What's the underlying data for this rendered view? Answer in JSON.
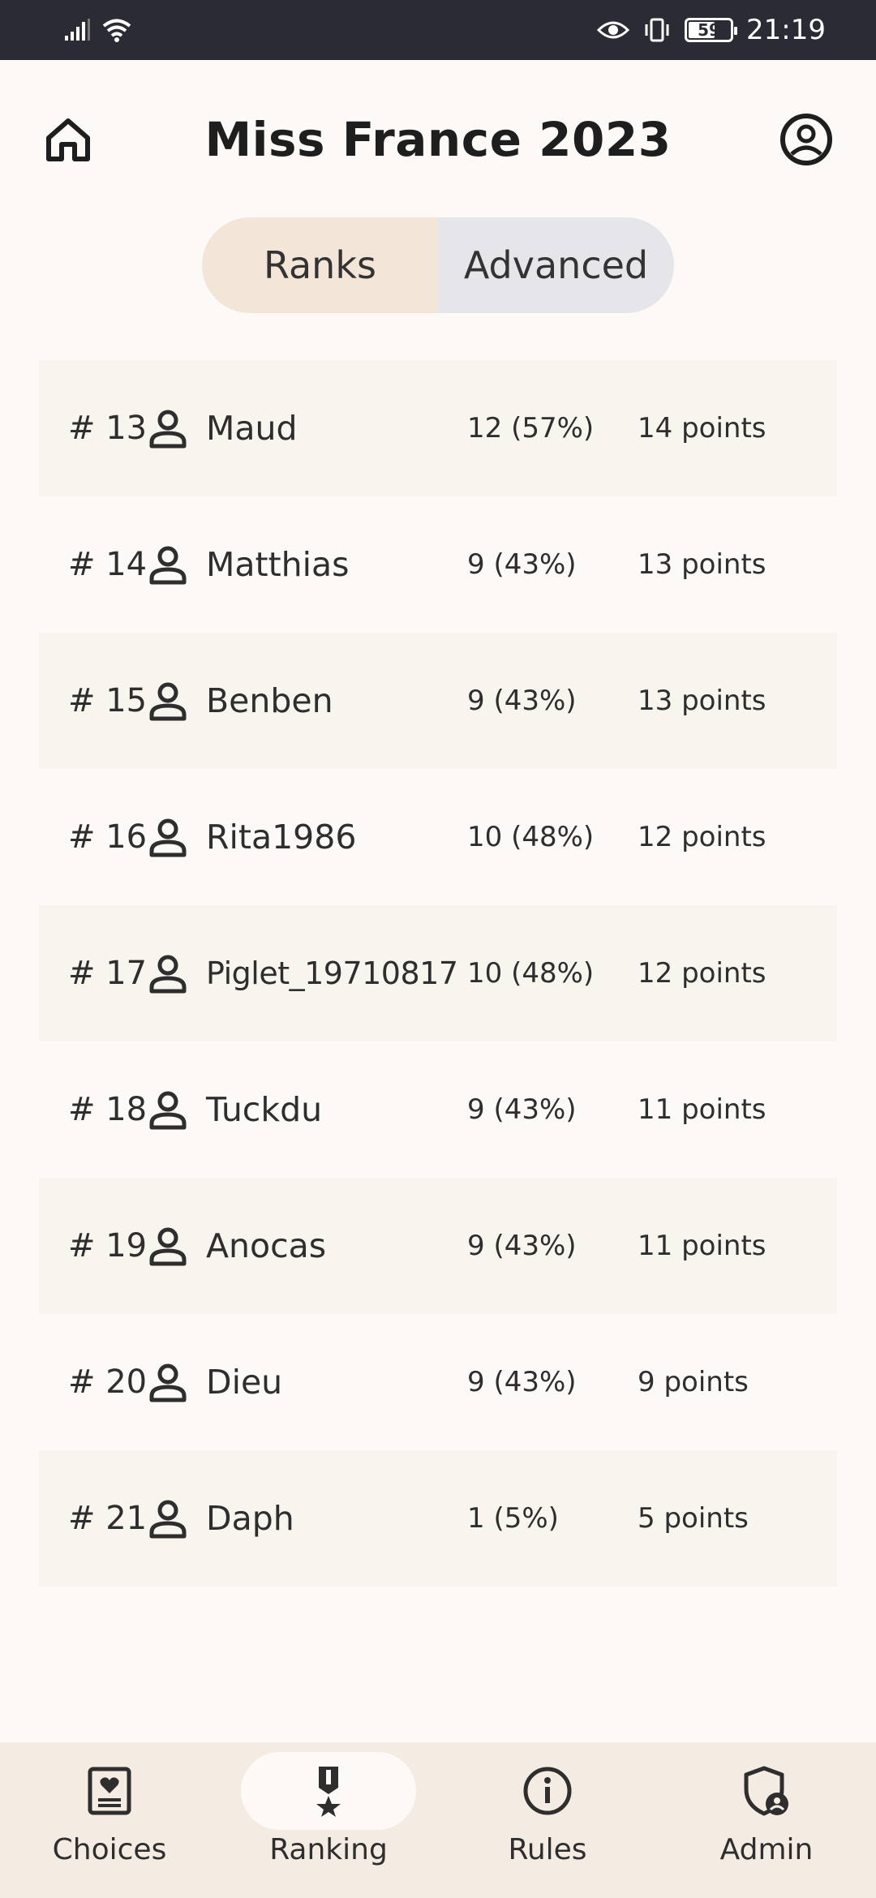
{
  "status_bar": {
    "time": "21:19",
    "battery": "59"
  },
  "header": {
    "title": "Miss France 2023"
  },
  "tabs": [
    {
      "label": "Ranks",
      "active": true
    },
    {
      "label": "Advanced",
      "active": false
    }
  ],
  "rankings": [
    {
      "rank": "# 13",
      "name": "Maud",
      "correct": "12 (57%)",
      "points": "14 points"
    },
    {
      "rank": "# 14",
      "name": "Matthias",
      "correct": "9 (43%)",
      "points": "13 points"
    },
    {
      "rank": "# 15",
      "name": "Benben",
      "correct": "9 (43%)",
      "points": "13 points"
    },
    {
      "rank": "# 16",
      "name": "Rita1986",
      "correct": "10 (48%)",
      "points": "12 points"
    },
    {
      "rank": "# 17",
      "name": "Piglet_19710817",
      "correct": "10 (48%)",
      "points": "12 points"
    },
    {
      "rank": "# 18",
      "name": "Tuckdu",
      "correct": "9 (43%)",
      "points": "11 points"
    },
    {
      "rank": "# 19",
      "name": "Anocas",
      "correct": "9 (43%)",
      "points": "11 points"
    },
    {
      "rank": "# 20",
      "name": "Dieu",
      "correct": "9 (43%)",
      "points": "9 points"
    },
    {
      "rank": "# 21",
      "name": "Daph",
      "correct": "1 (5%)",
      "points": "5 points"
    }
  ],
  "bottom_nav": [
    {
      "label": "Choices",
      "icon": "card-heart-icon",
      "active": false
    },
    {
      "label": "Ranking",
      "icon": "medal-icon",
      "active": true
    },
    {
      "label": "Rules",
      "icon": "info-icon",
      "active": false
    },
    {
      "label": "Admin",
      "icon": "shield-account-icon",
      "active": false
    }
  ]
}
